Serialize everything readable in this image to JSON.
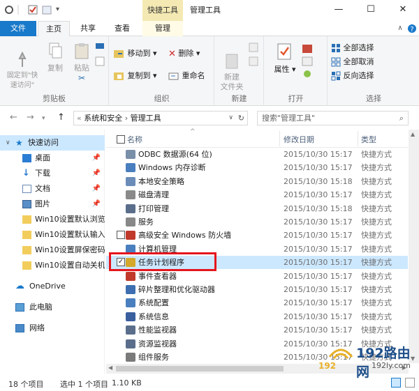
{
  "titlebar": {
    "context_tools": "快捷工具",
    "window_title": "管理工具",
    "controls": [
      "—",
      "☐",
      "✕"
    ]
  },
  "tabs": {
    "file": "文件",
    "home": "主页",
    "share": "共享",
    "view": "查看",
    "manage": "管理"
  },
  "ribbon": {
    "clipboard": {
      "label": "剪贴板",
      "pin": "固定到\"快\n速访问\"",
      "copy": "复制",
      "paste": "粘贴"
    },
    "organize": {
      "label": "组织",
      "move_to": "移动到",
      "copy_to": "复制到",
      "delete": "删除",
      "rename": "重命名"
    },
    "new": {
      "label": "新建",
      "new_folder": "新建\n文件夹"
    },
    "open": {
      "label": "打开",
      "properties": "属性"
    },
    "select": {
      "label": "选择",
      "select_all": "全部选择",
      "select_none": "全部取消",
      "invert": "反向选择"
    }
  },
  "address": {
    "back": "←",
    "forward": "→",
    "up": "↑",
    "crumbs": [
      "系统和安全",
      "管理工具"
    ],
    "search_placeholder": "搜索\"管理工具\""
  },
  "navpane": {
    "items": [
      {
        "label": "快速访问",
        "sel": true
      },
      {
        "label": "桌面",
        "pin": true
      },
      {
        "label": "下载",
        "pin": true
      },
      {
        "label": "文档",
        "pin": true
      },
      {
        "label": "图片",
        "pin": true
      },
      {
        "label": "Win10设置默认浏览"
      },
      {
        "label": "Win10设置默认输入"
      },
      {
        "label": "Win10设置屏保密码"
      },
      {
        "label": "Win10设置自动关机"
      },
      {
        "label": "OneDrive"
      },
      {
        "label": "此电脑"
      },
      {
        "label": "网络"
      }
    ]
  },
  "filelist": {
    "headers": {
      "name": "名称",
      "date": "修改日期",
      "type": "类型"
    },
    "rows": [
      {
        "name": "ODBC 数据源(64 位)",
        "date": "2015/10/30 15:17",
        "type": "快捷方式",
        "color": "#7a8fa8"
      },
      {
        "name": "Windows 内存诊断",
        "date": "2015/10/30 15:17",
        "type": "快捷方式",
        "color": "#4a7fbf"
      },
      {
        "name": "本地安全策略",
        "date": "2015/10/30 15:18",
        "type": "快捷方式",
        "color": "#6b8cb8"
      },
      {
        "name": "磁盘清理",
        "date": "2015/10/30 15:17",
        "type": "快捷方式",
        "color": "#8a8a8a"
      },
      {
        "name": "打印管理",
        "date": "2015/10/30 15:18",
        "type": "快捷方式",
        "color": "#5a6e8c"
      },
      {
        "name": "服务",
        "date": "2015/10/30 15:17",
        "type": "快捷方式",
        "color": "#888"
      },
      {
        "name": "高级安全 Windows 防火墙",
        "date": "2015/10/30 15:17",
        "type": "快捷方式",
        "color": "#c0392b"
      },
      {
        "name": "计算机管理",
        "date": "2015/10/30 15:17",
        "type": "快捷方式",
        "color": "#4a7fbf"
      },
      {
        "name": "任务计划程序",
        "date": "2015/10/30 15:17",
        "type": "快捷方式",
        "color": "#d4a82b",
        "sel": true
      },
      {
        "name": "事件查看器",
        "date": "2015/10/30 15:17",
        "type": "快捷方式",
        "color": "#c0392b"
      },
      {
        "name": "碎片整理和优化驱动器",
        "date": "2015/10/30 15:17",
        "type": "快捷方式",
        "color": "#3d6fb0"
      },
      {
        "name": "系统配置",
        "date": "2015/10/30 15:17",
        "type": "快捷方式",
        "color": "#4a7fbf"
      },
      {
        "name": "系统信息",
        "date": "2015/10/30 15:17",
        "type": "快捷方式",
        "color": "#3a5f9f"
      },
      {
        "name": "性能监视器",
        "date": "2015/10/30 15:17",
        "type": "快捷方式",
        "color": "#5a6e8c"
      },
      {
        "name": "资源监视器",
        "date": "2015/10/30 15:17",
        "type": "快捷方式",
        "color": "#5a6e8c"
      },
      {
        "name": "组件服务",
        "date": "2015/10/30 15:17",
        "type": "快捷方式",
        "color": "#7a7a7a"
      }
    ]
  },
  "status": {
    "count": "18 个项目",
    "selection": "选中 1 个项目",
    "size": "1.10 KB"
  },
  "watermark": {
    "brand": "192路由网",
    "url": "192ly.com"
  }
}
